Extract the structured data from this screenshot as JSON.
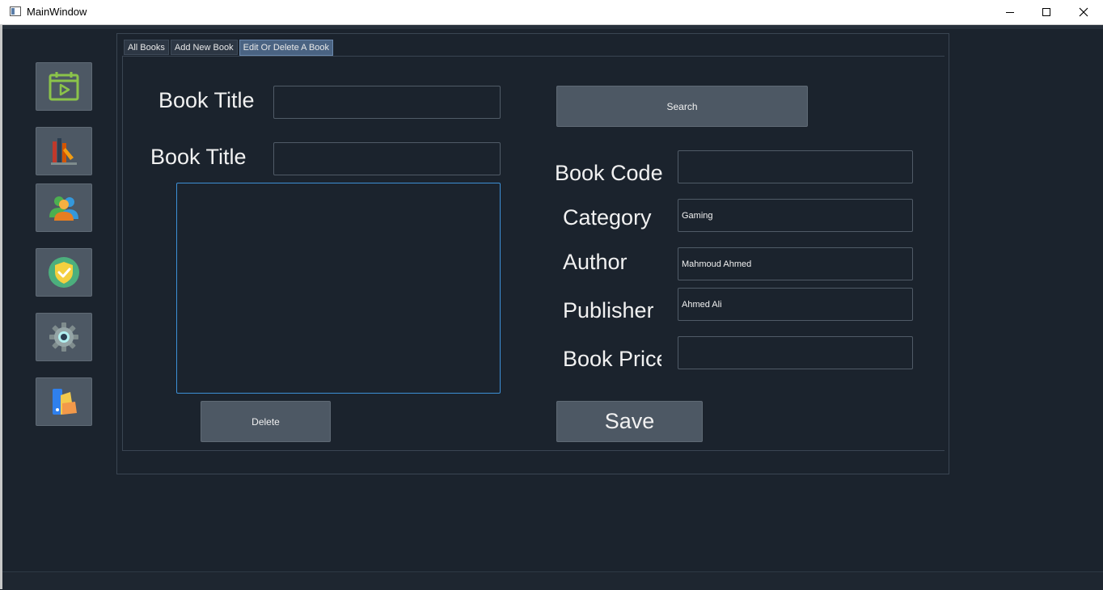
{
  "window": {
    "title": "MainWindow"
  },
  "sidebar": {
    "items": [
      {
        "icon": "calendar-play-icon"
      },
      {
        "icon": "books-icon"
      },
      {
        "icon": "users-icon"
      },
      {
        "icon": "shield-check-icon"
      },
      {
        "icon": "gear-icon"
      },
      {
        "icon": "color-palette-icon"
      }
    ]
  },
  "tabs": [
    {
      "label": "All Books"
    },
    {
      "label": "Add New Book"
    },
    {
      "label": "Edit Or Delete A Book",
      "active": true
    }
  ],
  "form": {
    "search_title_label": "Book Title",
    "search_title_value": "",
    "search_button": "Search",
    "book_title_label": "Book Title",
    "book_title_value": "",
    "description_value": "",
    "delete_button": "Delete",
    "book_code_label": "Book Code",
    "book_code_value": "",
    "category_label": "Category",
    "category_value": "Gaming",
    "author_label": "Author",
    "author_value": "Mahmoud Ahmed",
    "publisher_label": "Publisher",
    "publisher_value": "Ahmed Ali",
    "price_label": "Book Price",
    "price_value": "",
    "save_button": "Save"
  },
  "colors": {
    "background": "#1b232d",
    "button": "#4d5864",
    "active_tab": "#4a6382",
    "focus_border": "#3d8fd6"
  }
}
